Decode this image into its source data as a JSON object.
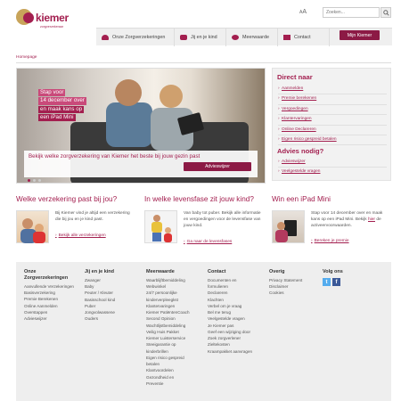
{
  "header": {
    "logo_text": "kiemer",
    "logo_sub": "zorgverzekeraar",
    "text_size_label": "A",
    "text_size_label_big": "A",
    "search_placeholder": "Zoeken..."
  },
  "nav": {
    "items": [
      {
        "label": "Onze Zorgverzekeringen"
      },
      {
        "label": "Jij en je kind"
      },
      {
        "label": "Meerwaarde"
      },
      {
        "label": "Contact"
      }
    ],
    "mijn_label": "Mijn Kiemer"
  },
  "breadcrumb": "Homepage",
  "hero": {
    "promo_lines": [
      "Stap voor",
      "14 december over",
      "en maak kans op",
      "een iPad Mini"
    ],
    "caption": "Bekijk welke zorgverzekering van Kiemer het beste bij jouw gezin past",
    "button": "Advieswijzer"
  },
  "sidebar": {
    "direct_title": "Direct naar",
    "direct_items": [
      "Aanmelden",
      "Premie berekenen",
      "Vergoedingen",
      "Klantervaringen",
      "Online Declareren",
      "Eigen risico gespreid betalen"
    ],
    "advies_title": "Advies nodig?",
    "advies_items": [
      "Advieswijzer",
      "Veelgestelde vragen"
    ]
  },
  "sections": [
    {
      "title": "Welke verzekering past bij jou?",
      "text": "Bij Kiemer vind je altijd een verzekering die bij jou en je kind past.",
      "link": "Bekijk alle verzekeringen"
    },
    {
      "title": "In welke levensfase zit jouw kind?",
      "text": "Van baby tot puber. Bekijk alle informatie en vergoedingen voor de levensfase van jouw kind.",
      "link": "Ga naar de levensfases"
    },
    {
      "title": "Win een iPad Mini",
      "text_pre": "Stap voor 14 december over en maak kans op een iPad Mini. Bekijk ",
      "text_link": "hier",
      "text_post": " de activeervoorwaarden.",
      "link": "Bereken je premie"
    }
  ],
  "footer": {
    "columns": [
      {
        "title": "Onze Zorgverzekeringen",
        "items": [
          "Aanvullende Verzekeringen",
          "Basisverzekering",
          "Premie Berekenen",
          "Online Aanmelden",
          "Overstappen",
          "Advieswijzer"
        ]
      },
      {
        "title": "Jij en je kind",
        "items": [
          "Zwanger",
          "Baby",
          "Peuter / Kleuter",
          "Basisschool kind",
          "Puber",
          "Jongvolwassene",
          "Ouders"
        ]
      },
      {
        "title": "Meerwaarde",
        "items": [
          "Waarblijftbemiddeling",
          "Webwinkel",
          "24/7 persoonlijke",
          "kinderverpleegkst",
          "Klantervaringen",
          "Kiemer PatiëntenCoach",
          "Second Opinion",
          "Wachtlijstbemiddeling",
          "Veilig Huis Pakket",
          "Kiemer Luisterservice",
          "Steeigarantie op",
          "kinderbrillen",
          "Eigen risico gespreid",
          "betalen",
          "Klantvoordelen",
          "Gezondheid en",
          "Preventie"
        ]
      },
      {
        "title": "Contact",
        "items": [
          "Documenten en",
          "formulieren",
          "Declareren",
          "Klachten",
          "Verbel om je vraag",
          "Bel me terug",
          "Veelgestelde vragen",
          "Je Kiemer pas",
          "Geef een wijziging door",
          "Zoek zorgverlener",
          "Zieltekosten",
          "Kraampakket aanvragen"
        ]
      },
      {
        "title": "Overig",
        "items": [
          "Privacy Statement",
          "Disclaimer",
          "Cookies"
        ]
      }
    ],
    "social_title": "Volg ons",
    "social": [
      {
        "icon": "twitter-icon",
        "glyph": "t",
        "color": "#55acee"
      },
      {
        "icon": "facebook-icon",
        "glyph": "f",
        "color": "#3b5998"
      }
    ]
  },
  "colors": {
    "brand": "#a31f4f",
    "brand_dark": "#8c1a45",
    "gold": "#c8a45a"
  }
}
